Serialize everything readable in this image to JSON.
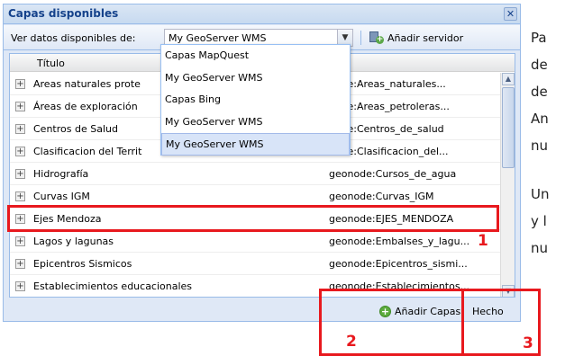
{
  "dialog": {
    "title": "Capas disponibles",
    "close_glyph": "✕"
  },
  "toolbar": {
    "label": "Ver datos disponibles de:",
    "combo_value": "My GeoServer WMS",
    "add_server_label": "Añadir servidor"
  },
  "dropdown": {
    "options": [
      "Capas MapQuest",
      "My GeoServer WMS",
      "Capas Bing",
      "My GeoServer WMS",
      "My GeoServer WMS"
    ]
  },
  "grid": {
    "header_title": "Título",
    "rows": [
      {
        "title": "Areas naturales prote",
        "name": "eode:Areas_naturales..."
      },
      {
        "title": "Áreas de exploración",
        "name": "eode:Areas_petroleras..."
      },
      {
        "title": "Centros de Salud",
        "name": "eode:Centros_de_salud"
      },
      {
        "title": "Clasificacion del Territ",
        "name": "eode:Clasificacion_del..."
      },
      {
        "title": "Hidrografía",
        "name": "geonode:Cursos_de_agua"
      },
      {
        "title": "Curvas IGM",
        "name": "geonode:Curvas_IGM"
      },
      {
        "title": "Ejes Mendoza",
        "name": "geonode:EJES_MENDOZA"
      },
      {
        "title": "Lagos y lagunas",
        "name": "geonode:Embalses_y_lagu..."
      },
      {
        "title": "Epicentros Sismicos",
        "name": "geonode:Epicentros_sismi..."
      },
      {
        "title": "Establecimientos educacionales",
        "name": "geonode:Establecimientos..."
      }
    ]
  },
  "footer": {
    "add_layers_label": "Añadir Capas",
    "done_label": "Hecho"
  },
  "annotations": {
    "n1": "1",
    "n2": "2",
    "n3": "3"
  },
  "side_text": [
    "Pa",
    "de",
    "de",
    "An",
    "nu",
    "Un",
    "y l",
    "nu"
  ],
  "colors": {
    "annotation_red": "#e8191e",
    "title_blue": "#15428b",
    "selection_blue": "#d8e4f8"
  }
}
